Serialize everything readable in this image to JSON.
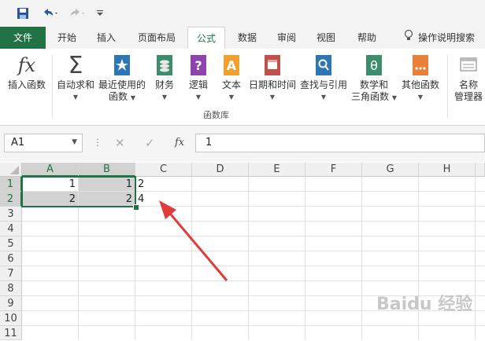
{
  "qat": {
    "icons": [
      "save-icon",
      "undo-icon",
      "redo-icon",
      "customize-qat-icon"
    ]
  },
  "tabs": [
    "文件",
    "开始",
    "插入",
    "页面布局",
    "公式",
    "数据",
    "审阅",
    "视图",
    "帮助"
  ],
  "tell_me": {
    "label": "操作说明搜索",
    "icon": "lightbulb-icon"
  },
  "ribbon": {
    "insert_function": "插入函数",
    "autosum": "自动求和",
    "recent_line1": "最近使用的",
    "recent_line2": "函数",
    "financial": "财务",
    "logical": "逻辑",
    "text": "文本",
    "datetime": "日期和时间",
    "lookup": "查找与引用",
    "math_line1": "数学和",
    "math_line2": "三角函数",
    "more": "其他函数",
    "name_mgr_line1": "名称",
    "name_mgr_line2": "管理器",
    "group_label": "函数库",
    "colors": {
      "green": "#217346",
      "blue": "#2e75b6",
      "purple": "#8e44ad",
      "orange": "#f0a030",
      "red": "#c0504d"
    }
  },
  "formula_bar": {
    "name_box": "A1",
    "fx": "fx",
    "value": "1"
  },
  "sheet": {
    "columns": [
      "A",
      "B",
      "C",
      "D",
      "E",
      "F",
      "G",
      "H"
    ],
    "rows": [
      "1",
      "2",
      "3",
      "4",
      "5",
      "6",
      "7",
      "8",
      "9",
      "10",
      "11"
    ],
    "selected_range": "A1:B2",
    "cells": {
      "A1": "1",
      "B1": "1",
      "C1": "2",
      "A2": "2",
      "B2": "2",
      "C2": "4"
    }
  },
  "watermark": "Baidu 经验"
}
